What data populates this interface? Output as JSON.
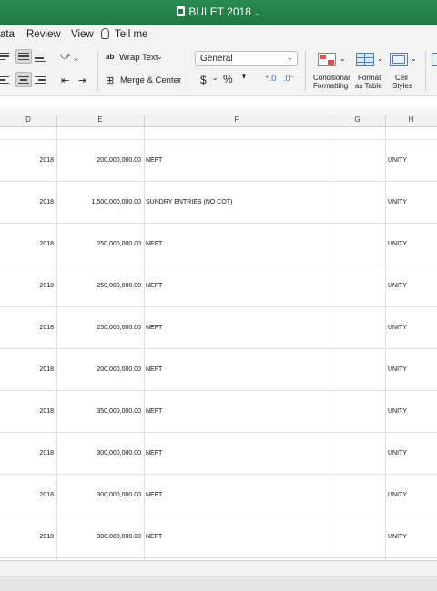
{
  "window": {
    "title": "BULET 2018"
  },
  "menu": {
    "tabs": [
      "ata",
      "Review",
      "View"
    ],
    "tell_me": "Tell me"
  },
  "ribbon": {
    "wrap_text": "Wrap Text",
    "merge_center": "Merge & Center",
    "number_format": "General",
    "currency_symbol": "$",
    "percent_symbol": "%",
    "comma_symbol": "❜",
    "conditional_formatting": [
      "Conditional",
      "Formatting"
    ],
    "format_as_table": [
      "Format",
      "as Table"
    ],
    "cell_styles": [
      "Cell",
      "Styles"
    ]
  },
  "columns": [
    "D",
    "E",
    "F",
    "G",
    "H"
  ],
  "rows": [
    {
      "year": "2018",
      "amount": "200,000,000.00",
      "desc": "NEFT",
      "bank": "UNITY"
    },
    {
      "year": "2018",
      "amount": "1,500,000,000.00",
      "desc": "SUNDRY ENTRIES (NO COT)",
      "bank": "UNITY"
    },
    {
      "year": "2018",
      "amount": "250,000,000.00",
      "desc": "NEFT",
      "bank": "UNITY"
    },
    {
      "year": "2018",
      "amount": "250,000,000.00",
      "desc": "NEFT",
      "bank": "UNITY"
    },
    {
      "year": "2018",
      "amount": "250,000,000.00",
      "desc": "NEFT",
      "bank": "UNITY"
    },
    {
      "year": "2018",
      "amount": "200,000,000.00",
      "desc": "NEFT",
      "bank": "UNITY"
    },
    {
      "year": "2018",
      "amount": "350,000,000.00",
      "desc": "NEFT",
      "bank": "UNITY"
    },
    {
      "year": "2018",
      "amount": "300,000,000.00",
      "desc": "NEFT",
      "bank": "UNITY"
    },
    {
      "year": "2018",
      "amount": "300,000,000.00",
      "desc": "NEFT",
      "bank": "UNITY"
    },
    {
      "year": "2018",
      "amount": "300,000,000.00",
      "desc": "NEFT",
      "bank": "UNITY"
    }
  ],
  "colors": {
    "title_bar": "#1f7744",
    "ribbon": "#f3f3f3",
    "gridline": "#e0e0e0"
  }
}
